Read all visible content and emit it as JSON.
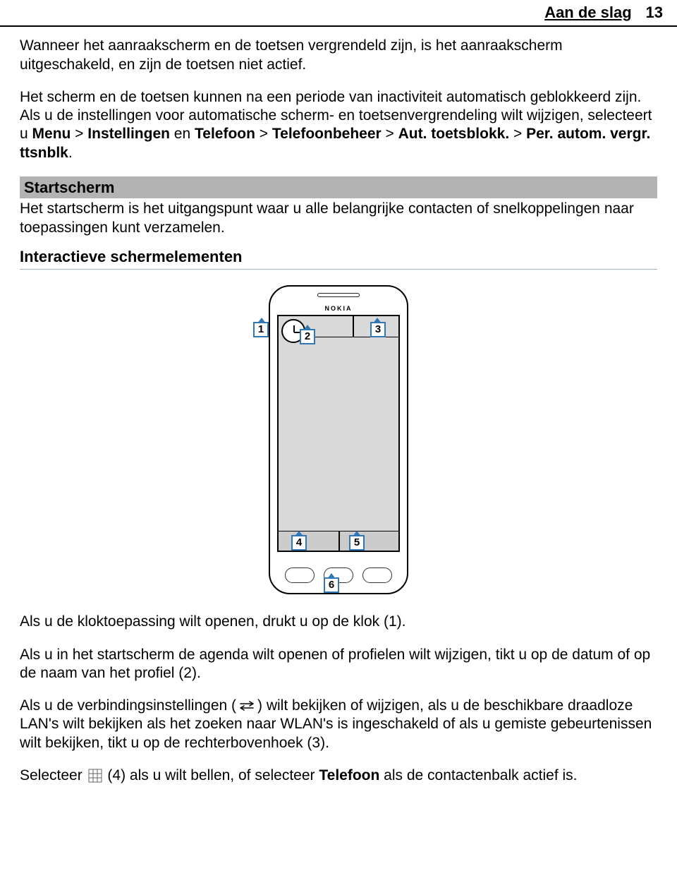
{
  "header": {
    "title": "Aan de slag",
    "page": "13"
  },
  "para1": "Wanneer het aanraakscherm en de toetsen vergrendeld zijn, is het aanraakscherm uitgeschakeld, en zijn de toetsen niet actief.",
  "para2a": "Het scherm en de toetsen kunnen na een periode van inactiviteit automatisch geblokkeerd zijn.",
  "para2b_intro": "Als u de instellingen voor automatische scherm- en toetsenvergrendeling wilt wijzigen, selecteert u ",
  "menu": {
    "m1": "Menu",
    "s1": " > ",
    "m2": "Instellingen",
    "and": " en ",
    "m3": "Telefoon",
    "m4": "Telefoonbeheer",
    "m5": "Aut. toetsblokk.",
    "m6": "Per. autom. vergr. ttsnblk"
  },
  "section": {
    "heading": "Startscherm",
    "desc": "Het startscherm is het uitgangspunt waar u alle belangrijke contacten of snelkoppelingen naar toepassingen kunt verzamelen."
  },
  "subheading": "Interactieve schermelementen",
  "phone": {
    "brand": "NOKIA",
    "callouts": {
      "c1": "1",
      "c2": "2",
      "c3": "3",
      "c4": "4",
      "c5": "5",
      "c6": "6"
    }
  },
  "para3": "Als u de kloktoepassing wilt openen, drukt u op de klok (1).",
  "para4": "Als u in het startscherm de agenda wilt openen of profielen wilt wijzigen, tikt u op de datum of op de naam van het profiel (2).",
  "para5a": "Als u de verbindingsinstellingen (",
  "para5b": ") wilt bekijken of wijzigen, als u de beschikbare draadloze LAN's wilt bekijken als het zoeken naar WLAN's is ingeschakeld of als u gemiste gebeurtenissen wilt bekijken, tikt u op de rechterbovenhoek (3).",
  "para6a": "Selecteer ",
  "para6b": " (4) als u wilt bellen, of selecteer ",
  "para6c": "Telefoon",
  "para6d": " als de contactenbalk actief is."
}
